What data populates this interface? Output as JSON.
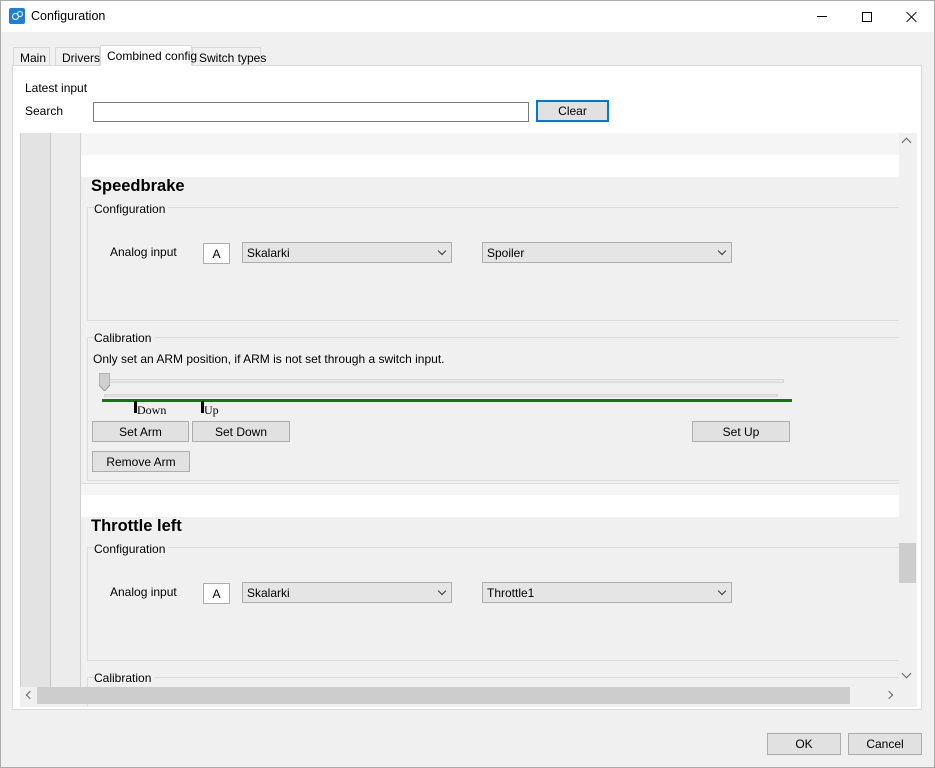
{
  "window": {
    "title": "Configuration"
  },
  "tabs": [
    {
      "label": "Main"
    },
    {
      "label": "Drivers"
    },
    {
      "label": "Combined config"
    },
    {
      "label": "Switch types"
    }
  ],
  "active_tab": "Combined config",
  "top": {
    "latest_input_label": "Latest input",
    "search_label": "Search",
    "search_value": "",
    "clear_label": "Clear"
  },
  "sections": [
    {
      "title": "Speedbrake",
      "configuration_label": "Configuration",
      "analog_input_label": "Analog input",
      "badge": "A",
      "device": "Skalarki",
      "axis": "Spoiler",
      "calibration_label": "Calibration",
      "calibration_note": "Only set an ARM position, if ARM is not set through a switch input.",
      "slider_value_percent": 0,
      "markers": [
        {
          "label": "Down",
          "position_percent": 5
        },
        {
          "label": "Up",
          "position_percent": 14
        }
      ],
      "buttons": {
        "set_arm": "Set Arm",
        "set_down": "Set Down",
        "set_up": "Set Up",
        "remove_arm": "Remove Arm"
      }
    },
    {
      "title": "Throttle left",
      "configuration_label": "Configuration",
      "analog_input_label": "Analog input",
      "badge": "A",
      "device": "Skalarki",
      "axis": "Throttle1",
      "calibration_label": "Calibration"
    }
  ],
  "footer": {
    "ok_label": "OK",
    "cancel_label": "Cancel"
  },
  "colors": {
    "accent": "#0078d7",
    "calibration_line": "#0e7a0e"
  },
  "icons": {
    "app": "configuration-app-icon"
  }
}
